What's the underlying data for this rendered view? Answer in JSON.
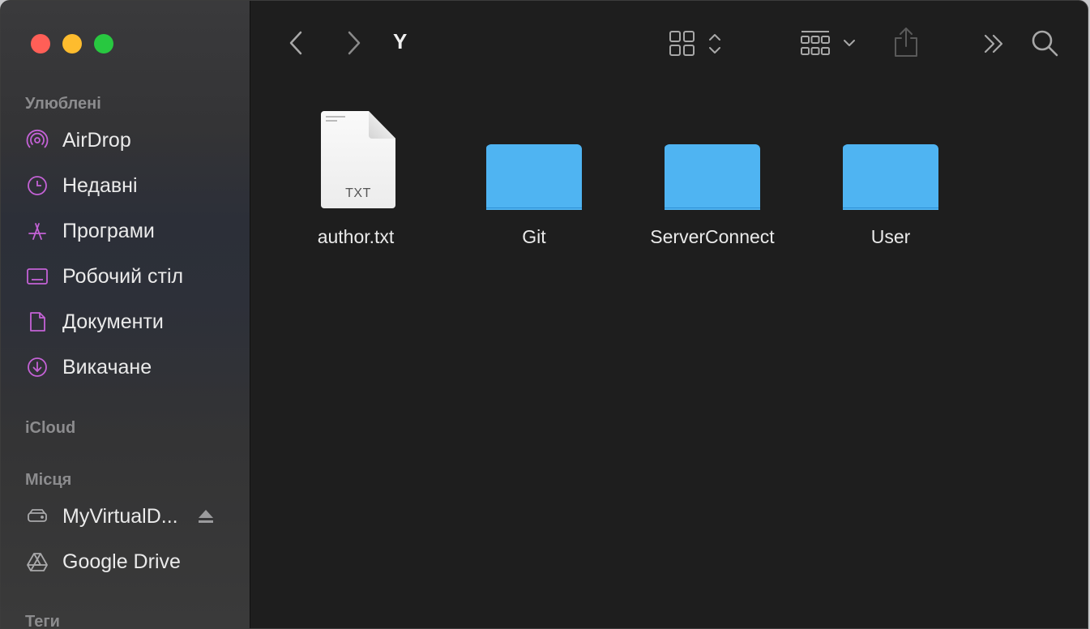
{
  "window": {
    "title": "Y"
  },
  "sidebar": {
    "favorites_title": "Улюблені",
    "favorites": [
      {
        "label": "AirDrop",
        "icon": "airdrop-icon"
      },
      {
        "label": "Недавні",
        "icon": "clock-icon"
      },
      {
        "label": "Програми",
        "icon": "applications-icon"
      },
      {
        "label": "Робочий стіл",
        "icon": "desktop-icon"
      },
      {
        "label": "Документи",
        "icon": "document-icon"
      },
      {
        "label": "Викачане",
        "icon": "download-icon"
      }
    ],
    "icloud_title": "iCloud",
    "locations_title": "Місця",
    "locations": [
      {
        "label": "MyVirtualD...",
        "icon": "drive-icon",
        "eject": true
      },
      {
        "label": "Google Drive",
        "icon": "google-drive-icon"
      }
    ],
    "tags_title": "Теги"
  },
  "toolbar": {
    "back_icon": "chevron-left-icon",
    "forward_icon": "chevron-right-icon",
    "view_icon": "icon-grid-view-icon",
    "group_icon": "group-icon",
    "share_icon": "share-icon",
    "more_icon": "more-chevrons-icon",
    "search_icon": "search-icon"
  },
  "files": [
    {
      "name": "author.txt",
      "type": "txt",
      "badge": "TXT"
    },
    {
      "name": "Git",
      "type": "folder"
    },
    {
      "name": "ServerConnect",
      "type": "folder"
    },
    {
      "name": "User",
      "type": "folder"
    }
  ],
  "colors": {
    "accent_icon": "#c462d6",
    "folder": "#4fb4f2",
    "background": "#1e1e1e"
  }
}
